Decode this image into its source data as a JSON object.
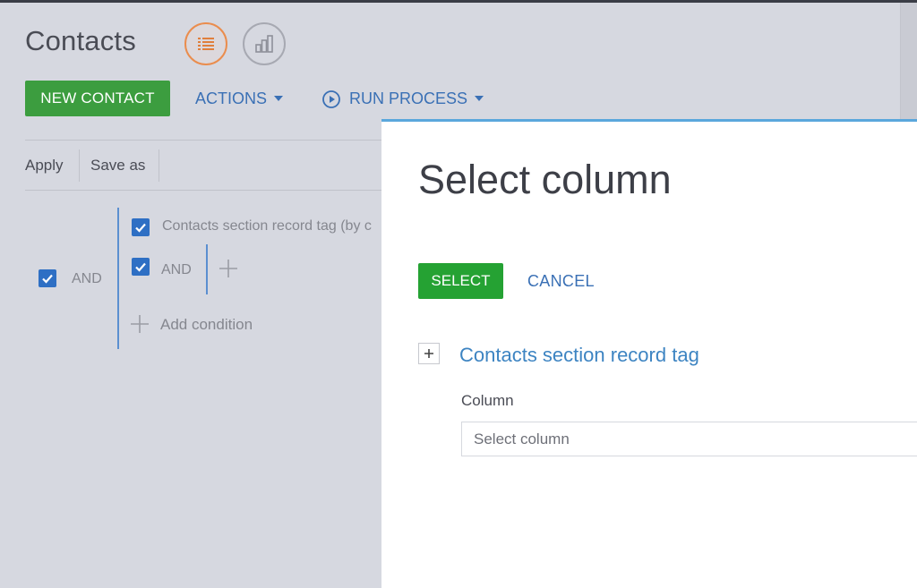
{
  "page": {
    "title": "Contacts"
  },
  "view_buttons": {
    "list_icon": "list-icon",
    "chart_icon": "bar-chart-icon"
  },
  "toolbar": {
    "new_contact": "NEW CONTACT",
    "actions": "ACTIONS",
    "run_process": "RUN PROCESS"
  },
  "filters": {
    "apply": "Apply",
    "save_as": "Save as",
    "root_operator": "AND",
    "condition_text": "Contacts section record tag (by c",
    "nested_operator": "AND",
    "add_condition": "Add condition"
  },
  "dialog": {
    "title": "Select column",
    "select_button": "SELECT",
    "cancel_button": "CANCEL",
    "group_title": "Contacts section record tag",
    "column_label": "Column",
    "column_placeholder": "Select column"
  },
  "colors": {
    "accent_green": "#25a233",
    "link_blue": "#3a70b5",
    "checkbox_blue": "#2e6fc4",
    "dialog_top_border": "#5aa7dc"
  }
}
